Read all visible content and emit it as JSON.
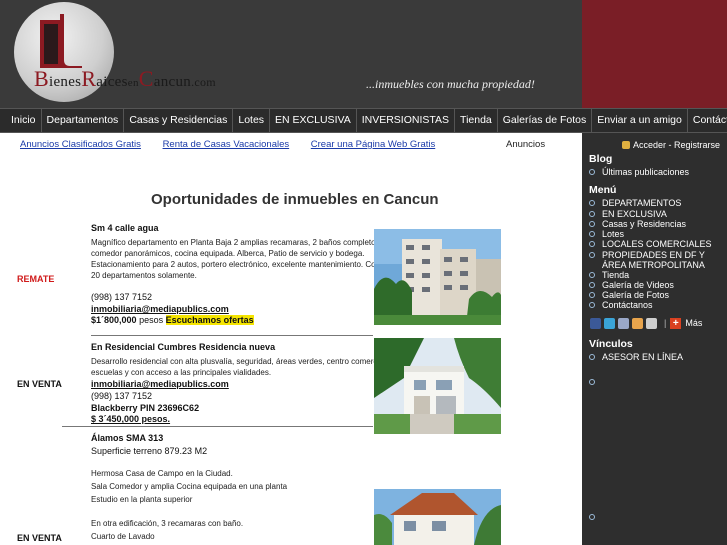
{
  "header": {
    "logo_text": {
      "b": "B",
      "b_rest": "ienes",
      "r": "R",
      "r_rest": "aices",
      "en": "en",
      "c": "C",
      "c_rest": "ancun",
      "com": ".com"
    },
    "tagline": "...inmuebles con mucha propiedad!"
  },
  "nav": {
    "items": [
      "Inicio",
      "Departamentos",
      "Casas y Residencias",
      "Lotes",
      "EN EXCLUSIVA",
      "INVERSIONISTAS",
      "Tienda",
      "Galerías de Fotos",
      "Enviar a un amigo",
      "Contáctanos"
    ]
  },
  "toplinks": {
    "items": [
      "Anuncios Clasificados Gratis",
      "Renta de Casas Vacacionales",
      "Crear una Página Web Gratis"
    ],
    "label": "Anuncios"
  },
  "main": {
    "title": "Oportunidades de inmuebles en Cancun",
    "listings": [
      {
        "status": "REMATE",
        "status_color": "#d01a1a",
        "heading": "Sm 4 calle agua",
        "desc": [
          "Magnífico departamento en Planta Baja  2 amplias recamaras, 2 baños completos, sala",
          "comedor panorámicos, cocina equipada. Alberca, Patio de servicio y bodega.",
          "Estacionamiento para 2 autos, portero electrónico, excelente mantenimiento.    Conjunto de",
          "20 departamentos solamente."
        ],
        "phone": "(998) 137 7152",
        "email": "inmobiliaria@mediapublics.com",
        "price": "$1´800,000",
        "price_unit": "pesos",
        "highlight": "Escuchamos ofertas"
      },
      {
        "status": "EN VENTA",
        "status_color": "#111111",
        "heading": "En Residencial Cumbres Residencia nueva",
        "desc": [
          "Desarrollo residencial con alta plusvalía, seguridad, áreas verdes, centro comercial, cerca de",
          "escuelas y con acceso a las principales vialidades."
        ],
        "email": "inmobiliaria@mediapublics.com",
        "phone": "(998) 137 7152",
        "pin": "Blackberry PIN 23696C62",
        "price": "$ 3´450,000 pesos."
      },
      {
        "status": "EN VENTA",
        "status_color": "#111111",
        "heading": "Álamos SMA 313",
        "sub": "Superficie terreno 879.23 M2",
        "desc": [
          "Hermosa Casa de Campo en la Ciudad.",
          "Sala Comedor y amplia Cocina equipada en una planta",
          "Estudio en la planta superior",
          "",
          "En otra edificación, 3 recamaras con baño.",
          "Cuarto de  Lavado"
        ]
      }
    ]
  },
  "sidebar": {
    "login": "Acceder - Registrarse",
    "blog_title": "Blog",
    "blog_items": [
      "Últimas publicaciones"
    ],
    "menu_title": "Menú",
    "menu_items": [
      "DEPARTAMENTOS",
      "EN EXCLUSIVA",
      "Casas y Residencias",
      "Lotes",
      "LOCALES COMERCIALES",
      "PROPIEDADES EN DF Y",
      "ÁREA METROPOLITANA",
      "Tienda",
      "Galería de Videos",
      "Galería de Fotos",
      "Contáctanos"
    ],
    "share_more": "Más",
    "links_title": "Vínculos",
    "links_items": [
      "ASESOR EN LÍNEA"
    ]
  },
  "colors": {
    "header_bg": "#3a3a3a",
    "header_accent": "#7a1e26",
    "nav_bg": "#2b2b2b",
    "sidebar_bg": "#2e2e2e",
    "link_blue": "#1a3aa8",
    "highlight_yellow": "#f5e500",
    "remate_red": "#d01a1a"
  }
}
